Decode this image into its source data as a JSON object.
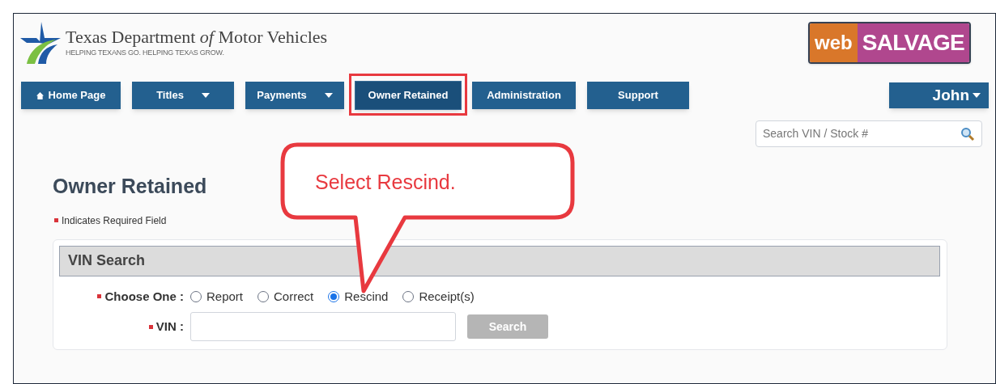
{
  "header": {
    "title_start": "Texas Department ",
    "title_of": "of",
    "title_end": " Motor Vehicles",
    "tagline": "HELPING TEXANS GO. HELPING TEXAS GROW.",
    "app_logo": {
      "part_1": "web",
      "part_2": "SALVAGE"
    }
  },
  "nav": [
    {
      "label": "Home Page",
      "kind": "home",
      "dropdown": false,
      "selected": false,
      "highlighted": false
    },
    {
      "label": "Titles",
      "dropdown": true,
      "selected": false,
      "highlighted": false
    },
    {
      "label": "Payments",
      "dropdown": true,
      "selected": false,
      "highlighted": false
    },
    {
      "label": "Owner Retained",
      "dropdown": false,
      "selected": true,
      "highlighted": true
    },
    {
      "label": "Administration",
      "dropdown": false,
      "selected": false,
      "highlighted": false
    },
    {
      "label": "Support",
      "dropdown": false,
      "selected": false,
      "highlighted": false
    }
  ],
  "user_menu": {
    "label": "John"
  },
  "search": {
    "placeholder": "Search VIN / Stock #"
  },
  "page_title": "Owner Retained",
  "required_note": "Indicates Required Field",
  "panel": {
    "title": "VIN Search",
    "choose_label": "Choose One :",
    "options": [
      {
        "label": "Report",
        "selected": false
      },
      {
        "label": "Correct",
        "selected": false
      },
      {
        "label": "Rescind",
        "selected": true
      },
      {
        "label": "Receipt(s)",
        "selected": false
      }
    ],
    "vin_label": "VIN :",
    "search_button": {
      "label": "Search",
      "disabled": true
    }
  },
  "callout": {
    "text": "Select Rescind."
  }
}
